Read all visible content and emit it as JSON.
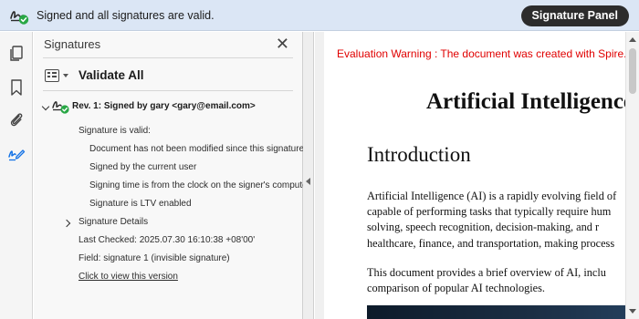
{
  "signature_bar": {
    "message": "Signed and all signatures are valid.",
    "panel_button": "Signature Panel",
    "icon": "signature-valid-icon"
  },
  "rail": {
    "icons": [
      "copy-pages-icon",
      "bookmark-icon",
      "attachment-paperclip-icon",
      "signature-pen-icon"
    ],
    "active": "signature-pen-icon"
  },
  "panel": {
    "title": "Signatures",
    "close_icon": "close-icon",
    "validate_all": "Validate All",
    "revision": "Rev. 1: Signed by gary <gary@email.com>",
    "valid_heading": "Signature is valid:",
    "details": [
      "Document has not been modified since this signature w",
      "Signed by the current user",
      "Signing time is from the clock on the signer's compute",
      "Signature is LTV enabled"
    ],
    "signature_details": "Signature Details",
    "last_checked": "Last Checked: 2025.07.30 16:10:38 +08'00'",
    "field": "Field: signature 1 (invisible signature)",
    "view_link": "Click to view this version"
  },
  "document": {
    "warning": "Evaluation Warning : The document was created with Spire.PDF fo",
    "title": "Artificial Intelligence",
    "heading": "Introduction",
    "para1": [
      "Artificial Intelligence (AI) is a rapidly evolving field of",
      "capable of performing tasks that typically require hum",
      "solving, speech recognition, decision-making, and r",
      "healthcare, finance, and transportation, making process"
    ],
    "para2": [
      "This document provides a brief overview of AI, inclu",
      "comparison of popular AI technologies."
    ]
  },
  "colors": {
    "bar_bg": "#dbe6f5",
    "valid_green": "#28a745",
    "warning_red": "#e00000",
    "button_dark": "#2c2c2c"
  }
}
